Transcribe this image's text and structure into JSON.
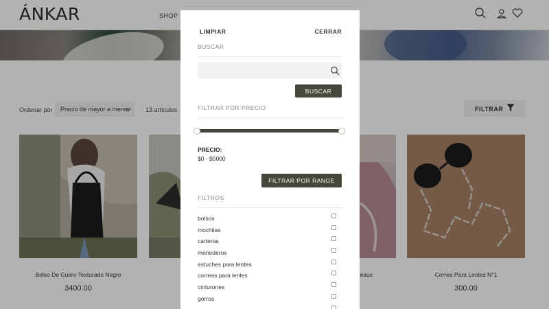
{
  "header": {
    "logo": "ÁNKAR",
    "nav_shop": "SHOP",
    "icons": [
      "search-icon",
      "user-icon",
      "heart-icon"
    ]
  },
  "toolbar": {
    "sort_label": "Ordenar por",
    "sort_value": "Precio de mayor a menor",
    "count": "13 artículos",
    "filter_label": "FILTRAR"
  },
  "products": [
    {
      "name": "Bolso De Cuero Texturado Negro",
      "price": "3400.00"
    },
    {
      "name": "Bolso D",
      "price": ""
    },
    {
      "name": "deaux",
      "price": ""
    },
    {
      "name": "Correa Para Lentes N°1",
      "price": "300.00"
    }
  ],
  "modal": {
    "clear": "LIMPIAR",
    "close": "CERRAR",
    "search_title": "BUSCAR",
    "search_placeholder": "",
    "search_button": "BUSCAR",
    "price_title": "FILTRAR POR PRECIO",
    "price_label": "PRECIO:",
    "price_range": "$0 - $5000",
    "range_button": "FILTRAR POR RANGE",
    "filters_title": "FILTROS",
    "filters": [
      "bolsos",
      "mochilas",
      "carteras",
      "monederos",
      "estuches para lentes",
      "correas para lentes",
      "cinturones",
      "gorros",
      ""
    ]
  },
  "colors": {
    "accent_dark": "#44473b",
    "overlay": "rgba(0,0,0,0.30)"
  }
}
